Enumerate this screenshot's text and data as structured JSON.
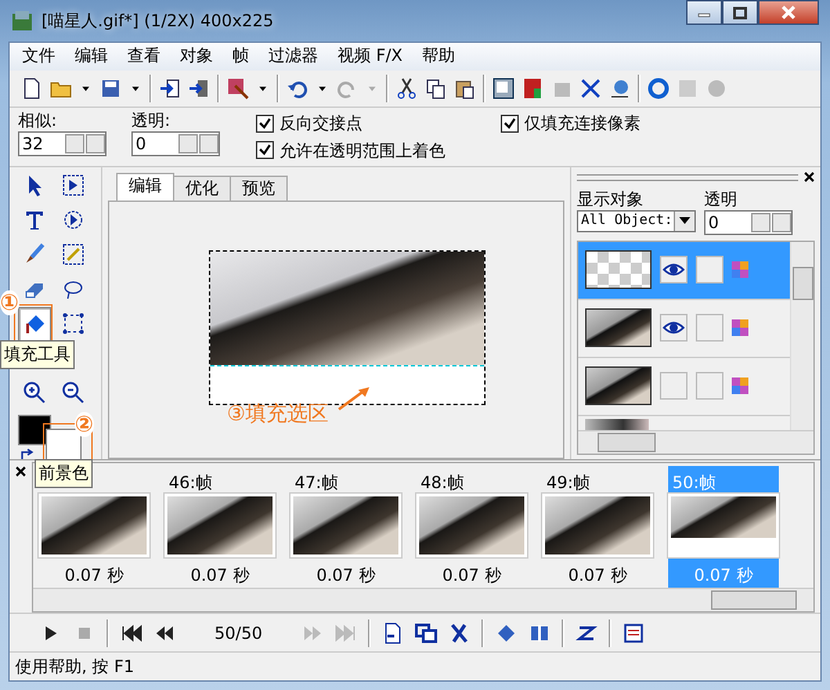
{
  "window": {
    "title": "[喵星人.gif*] (1/2X)  400x225"
  },
  "menu": [
    "文件",
    "编辑",
    "查看",
    "对象",
    "帧",
    "过滤器",
    "视频 F/X",
    "帮助"
  ],
  "options": {
    "fields": [
      {
        "label": "相似:",
        "value": "32"
      },
      {
        "label": "透明:",
        "value": "0"
      }
    ],
    "checkboxes": [
      {
        "label": "反向交接点",
        "checked": true
      },
      {
        "label": "允许在透明范围上着色",
        "checked": true
      },
      {
        "label": "仅填充连接像素",
        "checked": true
      }
    ]
  },
  "tools": [
    {
      "kind": "pointer",
      "selected": false
    },
    {
      "kind": "select",
      "selected": false
    },
    {
      "kind": "text",
      "selected": false
    },
    {
      "kind": "play",
      "selected": false
    },
    {
      "kind": "brush",
      "selected": false
    },
    {
      "kind": "wand",
      "selected": false
    },
    {
      "kind": "eraser",
      "selected": false
    },
    {
      "kind": "lasso",
      "selected": false
    },
    {
      "kind": "fill",
      "selected": true
    },
    {
      "kind": "crop",
      "selected": false
    },
    {
      "kind": "zoomin",
      "selected": false
    },
    {
      "kind": "zoomout",
      "selected": false
    }
  ],
  "tabs": [
    {
      "label": "编辑",
      "selected": true
    },
    {
      "label": "优化",
      "selected": false
    },
    {
      "label": "预览",
      "selected": false
    }
  ],
  "annotations": [
    {
      "marker": "①",
      "tooltip": "填充工具"
    },
    {
      "marker": "②",
      "tooltip": "前景色"
    },
    {
      "marker": "③",
      "tooltip": "填充选区"
    }
  ],
  "object_panel": {
    "show_label": "显示对象",
    "show_value": "All Object:",
    "opacity_label": "透明",
    "opacity_value": "0",
    "objects": [
      {
        "kind": "transparent",
        "selected": true,
        "visible": true
      },
      {
        "kind": "photo",
        "selected": false,
        "visible": true
      },
      {
        "kind": "photo",
        "selected": false,
        "visible": false
      }
    ]
  },
  "frames": [
    {
      "kind": "photo",
      "delay": "0.07 秒",
      "selected": false
    },
    {
      "label": "46:帧",
      "kind": "photo",
      "delay": "0.07 秒",
      "selected": false
    },
    {
      "label": "47:帧",
      "kind": "photo",
      "delay": "0.07 秒",
      "selected": false
    },
    {
      "label": "48:帧",
      "kind": "photo",
      "delay": "0.07 秒",
      "selected": false
    },
    {
      "label": "49:帧",
      "kind": "photo",
      "delay": "0.07 秒",
      "selected": false
    },
    {
      "label": "50:帧",
      "kind": "filled",
      "delay": "0.07 秒",
      "selected": true
    }
  ],
  "player": {
    "counter": "50/50"
  },
  "status_bar": "使用帮助, 按 F1"
}
